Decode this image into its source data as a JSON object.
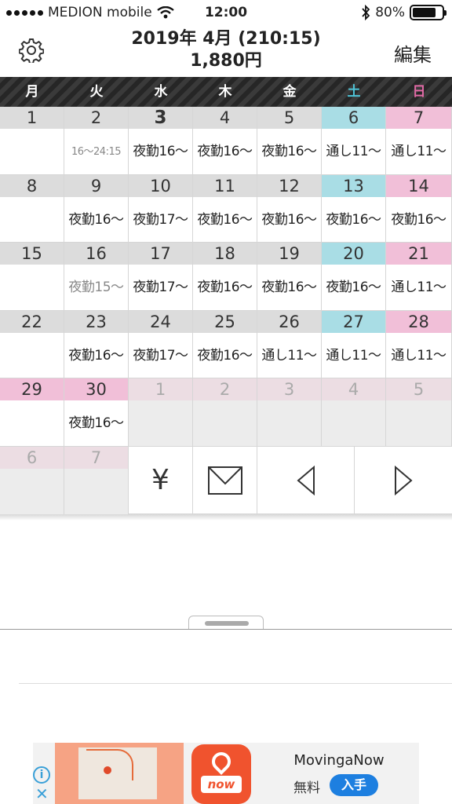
{
  "status_bar": {
    "carrier": "MEDION mobile",
    "time": "12:00",
    "battery": "80%",
    "battery_level": 0.8
  },
  "header": {
    "title_line1": "2019年 4月 (210:15)",
    "title_line2": "1,880円",
    "edit_label": "編集",
    "settings_icon": "gear-icon"
  },
  "weekdays": [
    "月",
    "火",
    "水",
    "木",
    "金",
    "土",
    "日"
  ],
  "colors": {
    "saturday": "#a9dde5",
    "sunday": "#f1bfd8",
    "header_bar": "#2e2e2e",
    "saturday_text": "#4ec3d6",
    "sunday_text": "#e06aa5"
  },
  "weeks": [
    [
      {
        "day": "1",
        "shift": ""
      },
      {
        "day": "2",
        "shift": "16〜24:15"
      },
      {
        "day": "3",
        "shift": "夜勤16〜"
      },
      {
        "day": "4",
        "shift": "夜勤16〜"
      },
      {
        "day": "5",
        "shift": "夜勤16〜"
      },
      {
        "day": "6",
        "shift": "通し11〜"
      },
      {
        "day": "7",
        "shift": "通し11〜"
      }
    ],
    [
      {
        "day": "8",
        "shift": ""
      },
      {
        "day": "9",
        "shift": "夜勤16〜"
      },
      {
        "day": "10",
        "shift": "夜勤17〜"
      },
      {
        "day": "11",
        "shift": "夜勤16〜"
      },
      {
        "day": "12",
        "shift": "夜勤16〜"
      },
      {
        "day": "13",
        "shift": "夜勤16〜"
      },
      {
        "day": "14",
        "shift": "夜勤16〜"
      }
    ],
    [
      {
        "day": "15",
        "shift": ""
      },
      {
        "day": "16",
        "shift": "夜勤15〜"
      },
      {
        "day": "17",
        "shift": "夜勤17〜"
      },
      {
        "day": "18",
        "shift": "夜勤16〜"
      },
      {
        "day": "19",
        "shift": "夜勤16〜"
      },
      {
        "day": "20",
        "shift": "夜勤16〜"
      },
      {
        "day": "21",
        "shift": "通し11〜"
      }
    ],
    [
      {
        "day": "22",
        "shift": ""
      },
      {
        "day": "23",
        "shift": "夜勤16〜"
      },
      {
        "day": "24",
        "shift": "夜勤17〜"
      },
      {
        "day": "25",
        "shift": "夜勤16〜"
      },
      {
        "day": "26",
        "shift": "通し11〜"
      },
      {
        "day": "27",
        "shift": "通し11〜"
      },
      {
        "day": "28",
        "shift": "通し11〜"
      }
    ],
    [
      {
        "day": "29",
        "shift": ""
      },
      {
        "day": "30",
        "shift": "夜勤16〜"
      },
      {
        "day": "1",
        "shift": ""
      },
      {
        "day": "2",
        "shift": ""
      },
      {
        "day": "3",
        "shift": ""
      },
      {
        "day": "4",
        "shift": ""
      },
      {
        "day": "5",
        "shift": ""
      }
    ],
    [
      {
        "day": "6",
        "shift": ""
      },
      {
        "day": "7",
        "shift": ""
      }
    ]
  ],
  "actions": {
    "salary_symbol": "¥"
  },
  "ad": {
    "app_name": "MovingaNow",
    "price": "無料",
    "cta": "入手",
    "icon_word": "now",
    "info_symbol": "i",
    "close_symbol": "✕"
  }
}
